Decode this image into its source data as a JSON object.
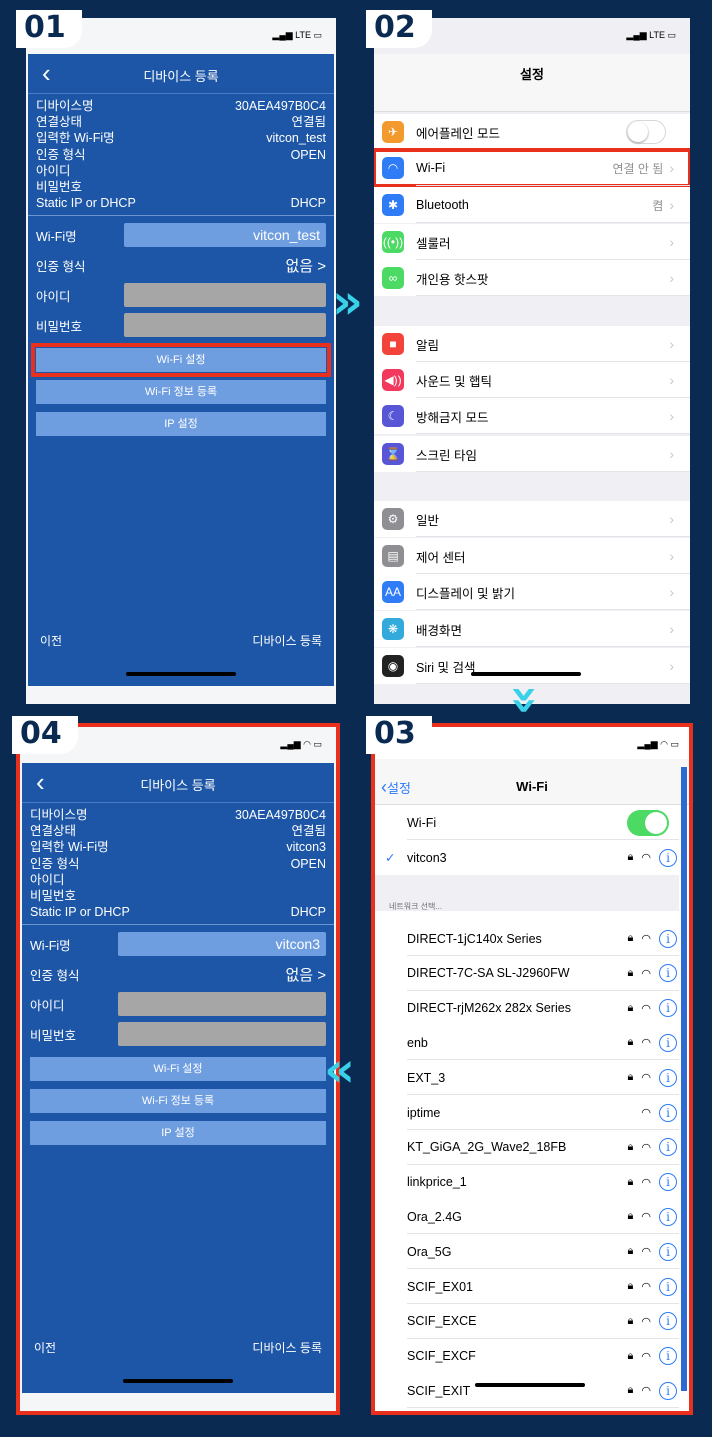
{
  "steps": [
    "01",
    "02",
    "03",
    "04"
  ],
  "status": {
    "carrier": "LTE"
  },
  "p1": {
    "title": "디바이스 등록",
    "info": [
      [
        "디바이스명",
        "30AEA497B0C4"
      ],
      [
        "연결상태",
        "연결됨"
      ],
      [
        "입력한 Wi-Fi명",
        "vitcon_test"
      ],
      [
        "인증 형식",
        "OPEN"
      ],
      [
        "아이디",
        ""
      ],
      [
        "비밀번호",
        ""
      ],
      [
        "Static IP or DHCP",
        "DHCP"
      ]
    ],
    "wifi_label": "Wi-Fi명",
    "wifi_value": "vitcon_test",
    "auth_label": "인증 형식",
    "auth_value": "없음",
    "id_label": "아이디",
    "pw_label": "비밀번호",
    "buttons": [
      "Wi-Fi 설정",
      "Wi-Fi 정보 등록",
      "IP 설정"
    ],
    "prev": "이전",
    "register": "디바이스 등록"
  },
  "p2": {
    "title": "설정",
    "rows": [
      {
        "label": "에어플레인 모드",
        "value": "",
        "color": "#f29a2e",
        "icon": "✈"
      },
      {
        "label": "Wi-Fi",
        "value": "연결 안 됨",
        "color": "#2f7cf6",
        "icon": "wifi"
      },
      {
        "label": "Bluetooth",
        "value": "켬",
        "color": "#2f7cf6",
        "icon": "✱"
      },
      {
        "label": "셀룰러",
        "value": "",
        "color": "#4cd964",
        "icon": "((•))"
      },
      {
        "label": "개인용 핫스팟",
        "value": "",
        "color": "#4cd964",
        "icon": "∞"
      },
      {
        "label": "알림",
        "value": "",
        "color": "#f2443a",
        "icon": "■"
      },
      {
        "label": "사운드 및 햅틱",
        "value": "",
        "color": "#f2385c",
        "icon": "◀))"
      },
      {
        "label": "방해금지 모드",
        "value": "",
        "color": "#5856d6",
        "icon": "☾"
      },
      {
        "label": "스크린 타임",
        "value": "",
        "color": "#5856d6",
        "icon": "⌛"
      },
      {
        "label": "일반",
        "value": "",
        "color": "#8e8e93",
        "icon": "⚙"
      },
      {
        "label": "제어 센터",
        "value": "",
        "color": "#8e8e93",
        "icon": "▤"
      },
      {
        "label": "디스플레이 및 밝기",
        "value": "",
        "color": "#2f7cf6",
        "icon": "AA"
      },
      {
        "label": "배경화면",
        "value": "",
        "color": "#34aadc",
        "icon": "❋"
      },
      {
        "label": "Siri 및 검색",
        "value": "",
        "color": "#222",
        "icon": "◉"
      }
    ]
  },
  "p3": {
    "back": "설정",
    "title": "Wi-Fi",
    "wifi_label": "Wi-Fi",
    "connected": "vitcon3",
    "section": "네트워크 선택...",
    "networks": [
      {
        "name": "DIRECT-1jC140x Series",
        "lock": true
      },
      {
        "name": "DIRECT-7C-SA SL-J2960FW",
        "lock": true
      },
      {
        "name": "DIRECT-rjM262x 282x Series",
        "lock": true
      },
      {
        "name": "enb",
        "lock": true
      },
      {
        "name": "EXT_3",
        "lock": true
      },
      {
        "name": "iptime",
        "lock": false
      },
      {
        "name": "KT_GiGA_2G_Wave2_18FB",
        "lock": true
      },
      {
        "name": "linkprice_1",
        "lock": true
      },
      {
        "name": "Ora_2.4G",
        "lock": true
      },
      {
        "name": "Ora_5G",
        "lock": true
      },
      {
        "name": "SCIF_EX01",
        "lock": true
      },
      {
        "name": "SCIF_EXCE",
        "lock": true
      },
      {
        "name": "SCIF_EXCF",
        "lock": true
      },
      {
        "name": "SCIF_EXIT",
        "lock": true
      }
    ]
  },
  "p4": {
    "title": "디바이스 등록",
    "info": [
      [
        "디바이스명",
        "30AEA497B0C4"
      ],
      [
        "연결상태",
        "연결됨"
      ],
      [
        "입력한 Wi-Fi명",
        "vitcon3"
      ],
      [
        "인증 형식",
        "OPEN"
      ],
      [
        "아이디",
        ""
      ],
      [
        "비밀번호",
        ""
      ],
      [
        "Static IP or DHCP",
        "DHCP"
      ]
    ],
    "wifi_label": "Wi-Fi명",
    "wifi_value": "vitcon3",
    "auth_label": "인증 형식",
    "auth_value": "없음",
    "id_label": "아이디",
    "pw_label": "비밀번호",
    "buttons": [
      "Wi-Fi 설정",
      "Wi-Fi 정보 등록",
      "IP 설정"
    ],
    "prev": "이전",
    "register": "디바이스 등록"
  }
}
